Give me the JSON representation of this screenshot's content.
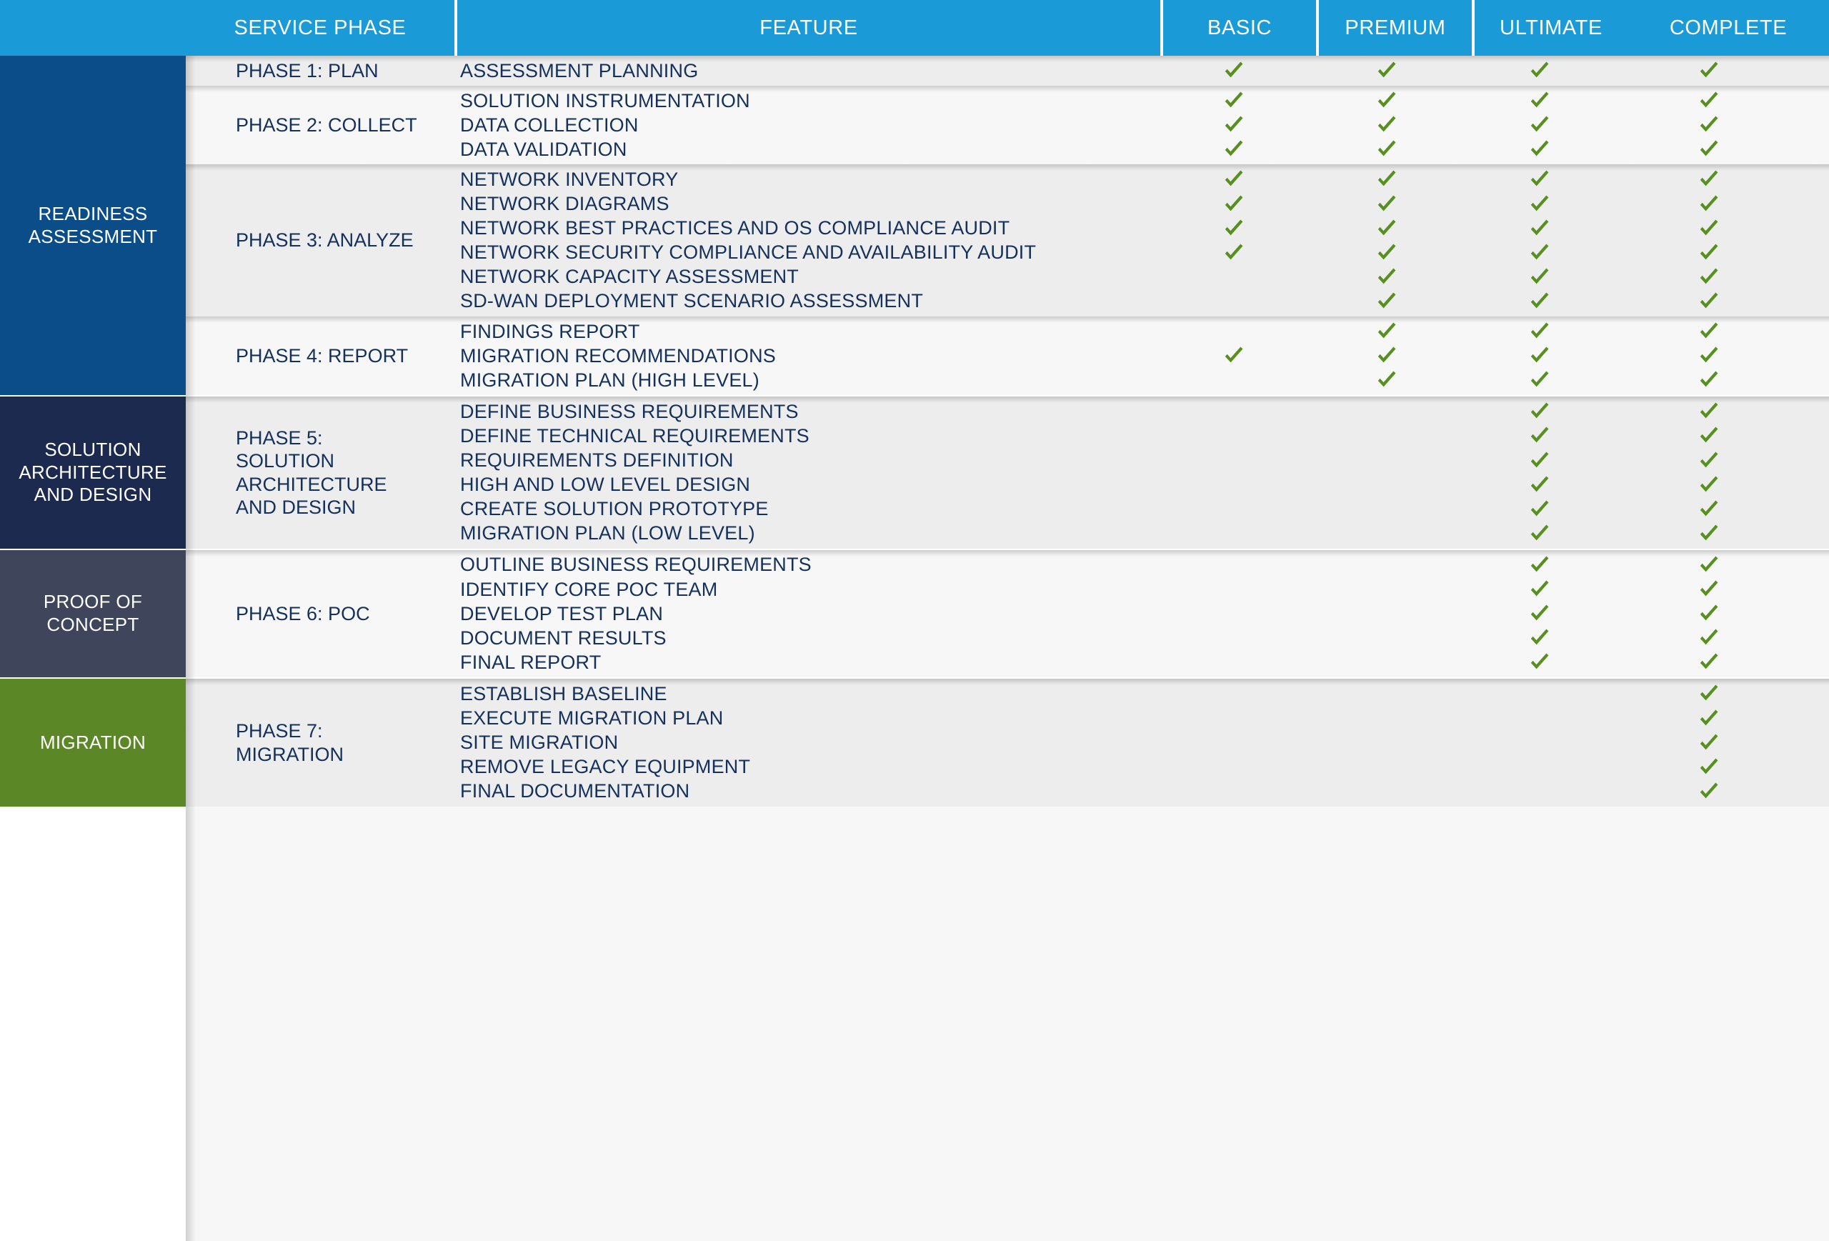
{
  "header": {
    "columns": [
      {
        "label": "SERVICE PHASE",
        "key": "service_phase"
      },
      {
        "label": "FEATURE",
        "key": "feature"
      },
      {
        "label": "BASIC",
        "key": "basic"
      },
      {
        "label": "PREMIUM",
        "key": "premium"
      },
      {
        "label": "ULTIMATE",
        "key": "ultimate"
      },
      {
        "label": "COMPLETE",
        "key": "complete"
      }
    ]
  },
  "colors": {
    "header_blue": "#1a9ad7",
    "category_readiness": "#0b4d88",
    "category_solution": "#1b2a4e",
    "category_poc": "#3f465c",
    "category_migration": "#5c8727",
    "check_green": "#57901f",
    "text_navy": "#14305c",
    "row_light": "#f7f7f7",
    "row_shade": "#ededed"
  },
  "tiers": [
    "BASIC",
    "PREMIUM",
    "ULTIMATE",
    "COMPLETE"
  ],
  "categories": [
    {
      "id": "readiness-assessment",
      "label": "READINESS\nASSESSMENT",
      "color": "#0b4d88",
      "phases": [
        {
          "id": "phase-1-plan",
          "label": "PHASE 1: PLAN",
          "shade": "b",
          "features": [
            {
              "label": "ASSESSMENT PLANNING",
              "tiers": [
                true,
                true,
                true,
                true
              ]
            }
          ]
        },
        {
          "id": "phase-2-collect",
          "label": "PHASE 2: COLLECT",
          "shade": "a",
          "features": [
            {
              "label": "SOLUTION INSTRUMENTATION",
              "tiers": [
                true,
                true,
                true,
                true
              ]
            },
            {
              "label": "DATA COLLECTION",
              "tiers": [
                true,
                true,
                true,
                true
              ]
            },
            {
              "label": "DATA VALIDATION",
              "tiers": [
                true,
                true,
                true,
                true
              ]
            }
          ]
        },
        {
          "id": "phase-3-analyze",
          "label": "PHASE 3: ANALYZE",
          "shade": "b",
          "features": [
            {
              "label": "NETWORK INVENTORY",
              "tiers": [
                true,
                true,
                true,
                true
              ]
            },
            {
              "label": "NETWORK DIAGRAMS",
              "tiers": [
                true,
                true,
                true,
                true
              ]
            },
            {
              "label": "NETWORK BEST PRACTICES AND OS COMPLIANCE AUDIT",
              "tiers": [
                true,
                true,
                true,
                true
              ]
            },
            {
              "label": "NETWORK SECURITY COMPLIANCE AND AVAILABILITY AUDIT",
              "tiers": [
                true,
                true,
                true,
                true
              ]
            },
            {
              "label": "NETWORK CAPACITY ASSESSMENT",
              "tiers": [
                false,
                true,
                true,
                true
              ]
            },
            {
              "label": "SD-WAN DEPLOYMENT SCENARIO ASSESSMENT",
              "tiers": [
                false,
                true,
                true,
                true
              ]
            }
          ]
        },
        {
          "id": "phase-4-report",
          "label": "PHASE 4: REPORT",
          "shade": "a",
          "features": [
            {
              "label": "FINDINGS REPORT",
              "tiers": [
                false,
                true,
                true,
                true
              ]
            },
            {
              "label": "MIGRATION RECOMMENDATIONS",
              "tiers": [
                true,
                true,
                true,
                true
              ]
            },
            {
              "label": "MIGRATION PLAN (HIGH LEVEL)",
              "tiers": [
                false,
                true,
                true,
                true
              ]
            }
          ]
        }
      ]
    },
    {
      "id": "solution-architecture-and-design",
      "label": "SOLUTION\nARCHITECTURE\nAND DESIGN",
      "color": "#1b2a4e",
      "phases": [
        {
          "id": "phase-5-solution-architecture-and-design",
          "label": "PHASE 5:\nSOLUTION\nARCHITECTURE\nAND DESIGN",
          "shade": "b",
          "features": [
            {
              "label": "DEFINE BUSINESS REQUIREMENTS",
              "tiers": [
                false,
                false,
                true,
                true
              ]
            },
            {
              "label": "DEFINE TECHNICAL REQUIREMENTS",
              "tiers": [
                false,
                false,
                true,
                true
              ]
            },
            {
              "label": "REQUIREMENTS DEFINITION",
              "tiers": [
                false,
                false,
                true,
                true
              ]
            },
            {
              "label": "HIGH AND LOW LEVEL DESIGN",
              "tiers": [
                false,
                false,
                true,
                true
              ]
            },
            {
              "label": "CREATE SOLUTION PROTOTYPE",
              "tiers": [
                false,
                false,
                true,
                true
              ]
            },
            {
              "label": "MIGRATION PLAN (LOW LEVEL)",
              "tiers": [
                false,
                false,
                true,
                true
              ]
            }
          ]
        }
      ]
    },
    {
      "id": "proof-of-concept",
      "label": "PROOF OF\nCONCEPT",
      "color": "#3f465c",
      "phases": [
        {
          "id": "phase-6-poc",
          "label": "PHASE 6: POC",
          "shade": "a",
          "features": [
            {
              "label": "OUTLINE BUSINESS REQUIREMENTS",
              "tiers": [
                false,
                false,
                true,
                true
              ]
            },
            {
              "label": "IDENTIFY CORE POC TEAM",
              "tiers": [
                false,
                false,
                true,
                true
              ]
            },
            {
              "label": "DEVELOP TEST PLAN",
              "tiers": [
                false,
                false,
                true,
                true
              ]
            },
            {
              "label": "DOCUMENT RESULTS",
              "tiers": [
                false,
                false,
                true,
                true
              ]
            },
            {
              "label": "FINAL REPORT",
              "tiers": [
                false,
                false,
                true,
                true
              ]
            }
          ]
        }
      ]
    },
    {
      "id": "migration",
      "label": "MIGRATION",
      "color": "#5c8727",
      "phases": [
        {
          "id": "phase-7-migration",
          "label": "PHASE 7:\nMIGRATION",
          "shade": "b",
          "features": [
            {
              "label": "ESTABLISH BASELINE",
              "tiers": [
                false,
                false,
                false,
                true
              ]
            },
            {
              "label": "EXECUTE MIGRATION PLAN",
              "tiers": [
                false,
                false,
                false,
                true
              ]
            },
            {
              "label": "SITE MIGRATION",
              "tiers": [
                false,
                false,
                false,
                true
              ]
            },
            {
              "label": "REMOVE LEGACY EQUIPMENT",
              "tiers": [
                false,
                false,
                false,
                true
              ]
            },
            {
              "label": "FINAL DOCUMENTATION",
              "tiers": [
                false,
                false,
                false,
                true
              ]
            }
          ]
        }
      ]
    }
  ]
}
